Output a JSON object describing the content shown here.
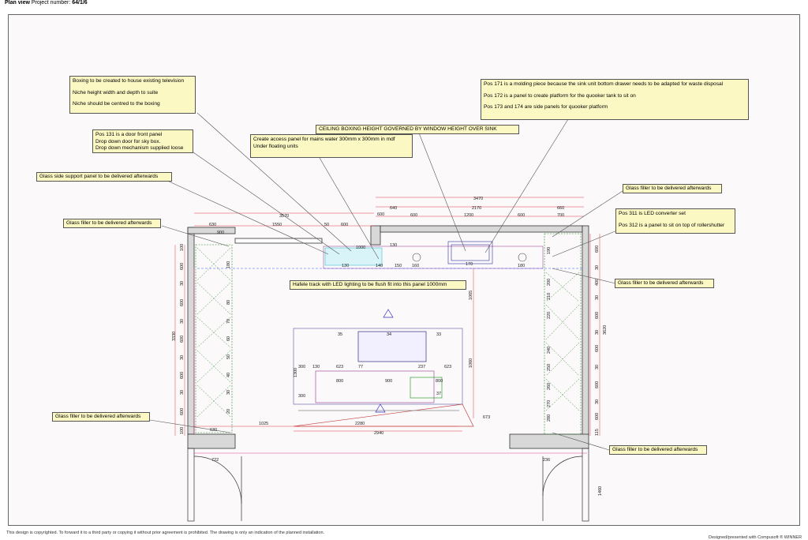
{
  "header": {
    "title": "Plan view",
    "project_label": "Project number:",
    "project_number": "64/1/6"
  },
  "notes": {
    "boxing": [
      "Boxing to be created to house existing television",
      "Niche height width and depth to suite",
      "Niche should be centred to the boxing"
    ],
    "pos131": [
      "Pos 131 is a door front panel",
      "Drop down door for sky box.",
      "Drop down mechanism supplied loose"
    ],
    "access": [
      "Create access panel for mains water 300mm x 300mm in mdf",
      "Under floating units"
    ],
    "ceiling": "CEILING BOXING HEIGHT GOVERNED BY WINDOW HEIGHT OVER SINK",
    "pos171": [
      "Pos 171 is a molding piece because the sink unit bottom drawer needs to be adapted for waste disposal",
      "Pos 172 is a panel to create platform for the quooker tank to sit on",
      "Pos 173 and 174  are side panels for quooker platform"
    ],
    "glass_side": "Glass side support panel to be delivered afterwards",
    "glass_filler_tl": "Glass filler to be delivered afterwards",
    "glass_filler_tr": "Glass filler to be delivered afterwards",
    "pos311": [
      "Pos 311 is LED converter set",
      "Pos 312 is a panel to sit on top of rollershutter"
    ],
    "hafele": "Hafele track with LED lighting to be flush fit into this panel 1000mm",
    "glass_filler_r": "Glass filler to be delivered afterwards",
    "glass_filler_bl": "Glass filler to be delivered afterwards",
    "glass_filler_br": "Glass filler to be delivered afterwards"
  },
  "dims": {
    "top_left": [
      "3570",
      "630",
      "1550",
      "50",
      "600",
      "900",
      "600",
      "1000",
      "130"
    ],
    "top_right": [
      "3470",
      "640",
      "2170",
      "660",
      "600",
      "1200",
      "600",
      "700",
      "300",
      "150"
    ],
    "left_total": "3330",
    "right_total": "3620",
    "left_col": [
      "100",
      "600",
      "30",
      "600",
      "30",
      "600",
      "30",
      "600",
      "30",
      "600",
      "100"
    ],
    "left_inner": [
      "180",
      "80",
      "70",
      "60",
      "50",
      "40",
      "30",
      "20"
    ],
    "right_col": [
      "600",
      "30",
      "400",
      "30",
      "600",
      "30",
      "600",
      "30",
      "600",
      "30",
      "600",
      "400",
      "30",
      "115"
    ],
    "right_inner": [
      "190",
      "200",
      "210",
      "220",
      "240",
      "250",
      "260",
      "270",
      "280"
    ],
    "island": [
      "35",
      "34",
      "33",
      "300",
      "130",
      "623",
      "77",
      "237",
      "623",
      "800",
      "900",
      "800",
      "37",
      "300",
      "300",
      "1300"
    ],
    "run_labels": [
      "130",
      "140",
      "150",
      "160",
      "170",
      "180"
    ],
    "bottom": [
      "1025",
      "630",
      "2280",
      "2940",
      "1065",
      "1060",
      "673"
    ],
    "door": [
      "722",
      "236",
      "1460"
    ]
  },
  "footer": {
    "left": "This design is copyrighted. To forward it to a third party or copying it without prior agreement is prohibited. The drawing is only an indication of the planned installation.",
    "right": "Designed/presented with Compusoft ® WINNER"
  }
}
